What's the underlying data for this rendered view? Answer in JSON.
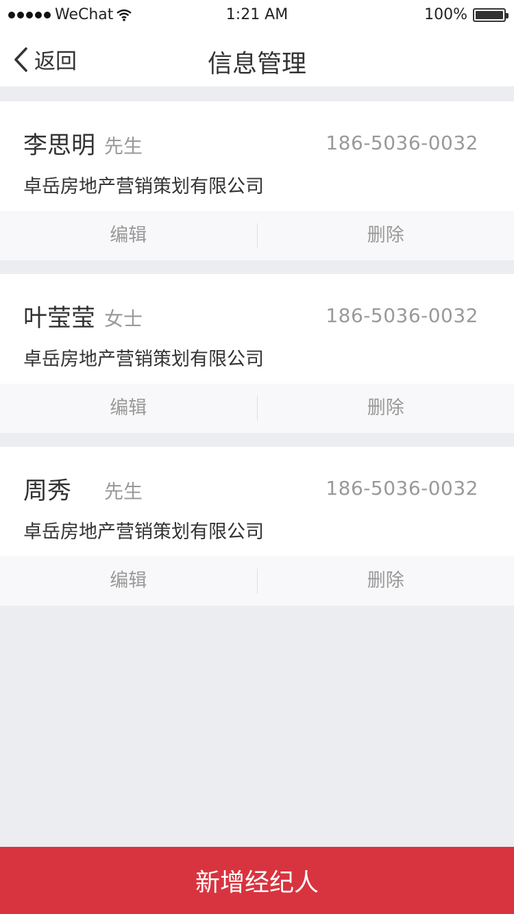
{
  "status_bar": {
    "carrier": "WeChat",
    "time": "1:21 AM",
    "battery_percent": "100%",
    "battery_level": 1.0
  },
  "nav": {
    "back_label": "返回",
    "title": "信息管理"
  },
  "agents": [
    {
      "name": "李思明",
      "salutation": "先生",
      "phone": "186-5036-0032",
      "company": "卓岳房地产营销策划有限公司",
      "edit_label": "编辑",
      "delete_label": "删除"
    },
    {
      "name": "叶莹莹",
      "salutation": "女士",
      "phone": "186-5036-0032",
      "company": "卓岳房地产营销策划有限公司",
      "edit_label": "编辑",
      "delete_label": "删除"
    },
    {
      "name": "周秀",
      "salutation": "先生",
      "phone": "186-5036-0032",
      "company": "卓岳房地产营销策划有限公司",
      "edit_label": "编辑",
      "delete_label": "删除"
    }
  ],
  "footer": {
    "add_label": "新增经纪人"
  },
  "colors": {
    "accent": "#d8343f",
    "background": "#ecedf1",
    "muted_text": "#999999"
  },
  "icons": {
    "back": "chevron-left-icon",
    "signal": "signal-dots-icon",
    "wifi": "wifi-icon",
    "battery": "battery-icon"
  }
}
